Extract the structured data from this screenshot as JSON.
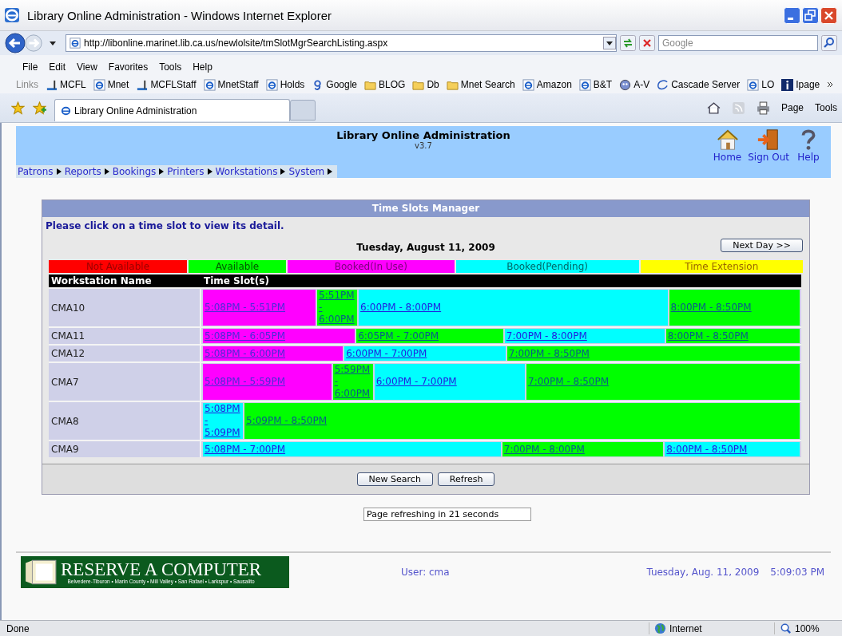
{
  "window": {
    "title": "Library Online Administration - Windows Internet Explorer"
  },
  "address": {
    "url": "http://libonline.marinet.lib.ca.us/newlolsite/tmSlotMgrSearchListing.aspx",
    "search_placeholder": "Google"
  },
  "menu": [
    "File",
    "Edit",
    "View",
    "Favorites",
    "Tools",
    "Help"
  ],
  "links": {
    "label": "Links",
    "items": [
      {
        "label": "MCFL",
        "kind": "bar"
      },
      {
        "label": "Mnet",
        "kind": "ie"
      },
      {
        "label": "MCFLStaff",
        "kind": "bar"
      },
      {
        "label": "MnetStaff",
        "kind": "ie"
      },
      {
        "label": "Holds",
        "kind": "ie"
      },
      {
        "label": "Google",
        "kind": "google"
      },
      {
        "label": "BLOG",
        "kind": "folder"
      },
      {
        "label": "Db",
        "kind": "folder"
      },
      {
        "label": "Mnet Search",
        "kind": "folder"
      },
      {
        "label": "Amazon",
        "kind": "ie"
      },
      {
        "label": "B&T",
        "kind": "ie"
      },
      {
        "label": "A-V",
        "kind": "globe"
      },
      {
        "label": "Cascade Server",
        "kind": "cascade"
      },
      {
        "label": "LO",
        "kind": "ie"
      },
      {
        "label": "Ipage",
        "kind": "info"
      }
    ]
  },
  "tab": {
    "title": "Library Online Administration"
  },
  "command_bar": [
    "Page",
    "Tools"
  ],
  "header": {
    "title": "Library Online Administration",
    "version": "v3.7",
    "actions": [
      {
        "label": "Home",
        "kind": "home"
      },
      {
        "label": "Sign Out",
        "kind": "exit"
      },
      {
        "label": "Help",
        "kind": "help"
      }
    ],
    "nav": [
      "Patrons",
      "Reports",
      "Bookings",
      "Printers",
      "Workstations",
      "System"
    ]
  },
  "panel": {
    "title": "Time Slots Manager",
    "instruction": "Please click on a time slot to view its detail.",
    "date": "Tuesday, August 11, 2009",
    "next_button": "Next Day >>",
    "legend": [
      {
        "label": "Not Available",
        "color": "#ff0000"
      },
      {
        "label": "Available",
        "color": "#00ff00"
      },
      {
        "label": "Booked(In Use)",
        "color": "#ff00ff"
      },
      {
        "label": "Booked(Pending)",
        "color": "#00ffff"
      },
      {
        "label": "Time Extension",
        "color": "#ffff00"
      }
    ],
    "columns": [
      "Workstation Name",
      "Time Slot(s)"
    ],
    "rows": [
      {
        "name": "CMA10",
        "slots": [
          {
            "label": "5:08PM - 5:51PM",
            "color": "#ff00ff"
          },
          {
            "label": "5:51PM - 6:00PM",
            "color": "#00ff00"
          },
          {
            "label": "6:00PM - 8:00PM",
            "color": "#00ffff"
          },
          {
            "label": "8:00PM - 8:50PM",
            "color": "#00ff00"
          }
        ]
      },
      {
        "name": "CMA11",
        "slots": [
          {
            "label": "5:08PM - 6:05PM",
            "color": "#ff00ff"
          },
          {
            "label": "6:05PM - 7:00PM",
            "color": "#00ff00"
          },
          {
            "label": "7:00PM - 8:00PM",
            "color": "#00ffff"
          },
          {
            "label": "8:00PM - 8:50PM",
            "color": "#00ff00"
          }
        ]
      },
      {
        "name": "CMA12",
        "slots": [
          {
            "label": "5:08PM - 6:00PM",
            "color": "#ff00ff"
          },
          {
            "label": "6:00PM - 7:00PM",
            "color": "#00ffff"
          },
          {
            "label": "7:00PM - 8:50PM",
            "color": "#00ff00"
          }
        ]
      },
      {
        "name": "CMA7",
        "slots": [
          {
            "label": "5:08PM - 5:59PM",
            "color": "#ff00ff"
          },
          {
            "label": "5:59PM - 6:00PM",
            "color": "#00ff00"
          },
          {
            "label": "6:00PM - 7:00PM",
            "color": "#00ffff"
          },
          {
            "label": "7:00PM - 8:50PM",
            "color": "#00ff00"
          }
        ]
      },
      {
        "name": "CMA8",
        "slots": [
          {
            "label": "5:08PM - 5:09PM",
            "color": "#00ffff"
          },
          {
            "label": "5:09PM - 8:50PM",
            "color": "#00ff00"
          }
        ]
      },
      {
        "name": "CMA9",
        "slots": [
          {
            "label": "5:08PM - 7:00PM",
            "color": "#00ffff"
          },
          {
            "label": "7:00PM - 8:00PM",
            "color": "#00ff00"
          },
          {
            "label": "8:00PM - 8:50PM",
            "color": "#00ffff"
          }
        ]
      }
    ],
    "buttons": [
      "New Search",
      "Refresh"
    ],
    "refresh_status": "Page refreshing in 21 seconds"
  },
  "footer": {
    "logo": "RESERVE A COMPUTER",
    "logo_tagline": "Belvedere-Tiburon • Marin County • Mill Valley • San Rafael • Larkspur • Sausalito",
    "user": "User: cma",
    "date": "Tuesday, Aug. 11, 2009",
    "time": "5:09:03 PM"
  },
  "status_bar": {
    "text": "Done",
    "zone": "Internet",
    "zoom": "100%"
  }
}
